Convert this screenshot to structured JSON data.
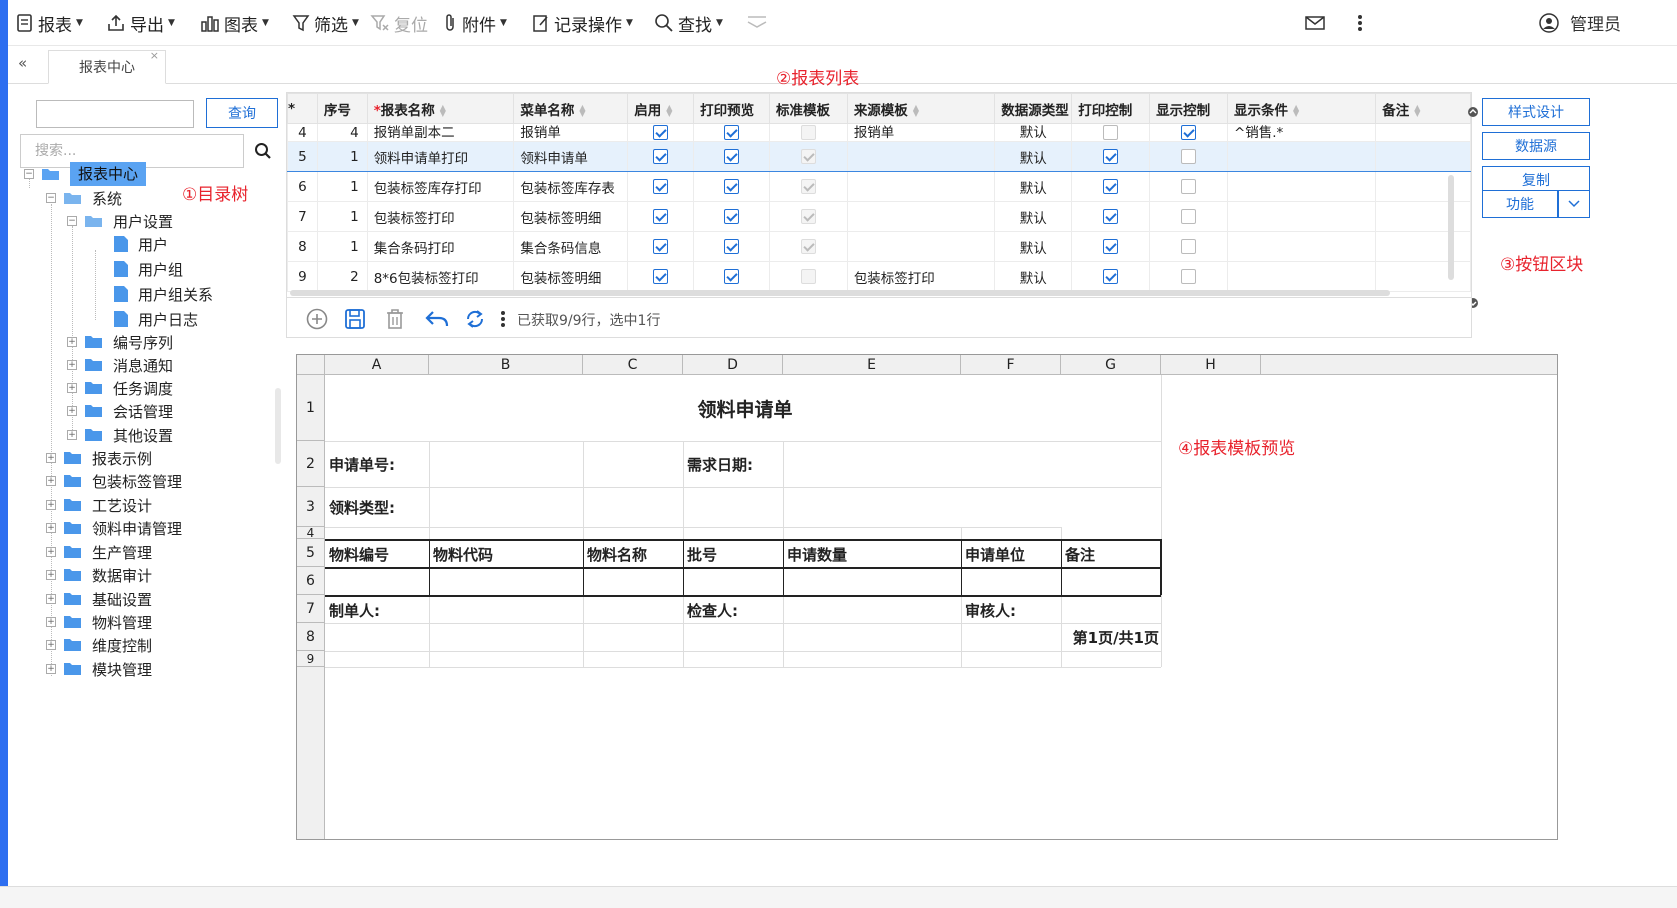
{
  "toolbar": {
    "report": "报表",
    "export": "导出",
    "chart": "图表",
    "filter": "筛选",
    "reset": "复位",
    "attachment": "附件",
    "record_ops": "记录操作",
    "find": "查找",
    "user": "管理员"
  },
  "tabs": {
    "collapse": "«",
    "active_tab": "报表中心",
    "close": "×"
  },
  "tree": {
    "query_button": "查询",
    "search_placeholder": "搜索...",
    "nodes": [
      "报表中心",
      "系统",
      "用户设置",
      "用户",
      "用户组",
      "用户组关系",
      "用户日志",
      "编号序列",
      "消息通知",
      "任务调度",
      "会话管理",
      "其他设置",
      "报表示例",
      "包装标签管理",
      "工艺设计",
      "领料申请管理",
      "生产管理",
      "数据审计",
      "基础设置",
      "物料管理",
      "维度控制",
      "模块管理"
    ]
  },
  "annotations": {
    "tree": "①目录树",
    "list": "②报表列表",
    "buttons": "③按钮区块",
    "preview": "④报表模板预览"
  },
  "grid": {
    "headers": [
      "*",
      "序号",
      "报表名称",
      "菜单名称",
      "启用",
      "打印预览",
      "标准模板",
      "来源模板",
      "数据源类型",
      "打印控制",
      "显示控制",
      "显示条件",
      "备注"
    ],
    "rows": [
      {
        "idx": "4",
        "seq": "4",
        "name": "报销单副本二",
        "menu": "报销单",
        "enabled": true,
        "preview": true,
        "std": false,
        "source": "报销单",
        "ds": "默认",
        "print": false,
        "show": true,
        "cond": "^销售.*",
        "note": ""
      },
      {
        "idx": "5",
        "seq": "1",
        "name": "领料申请单打印",
        "menu": "领料申请单",
        "enabled": true,
        "preview": true,
        "std": true,
        "source": "",
        "ds": "默认",
        "print": true,
        "show": false,
        "cond": "",
        "note": ""
      },
      {
        "idx": "6",
        "seq": "1",
        "name": "包装标签库存打印",
        "menu": "包装标签库存表",
        "enabled": true,
        "preview": true,
        "std": true,
        "source": "",
        "ds": "默认",
        "print": true,
        "show": false,
        "cond": "",
        "note": ""
      },
      {
        "idx": "7",
        "seq": "1",
        "name": "包装标签打印",
        "menu": "包装标签明细",
        "enabled": true,
        "preview": true,
        "std": true,
        "source": "",
        "ds": "默认",
        "print": true,
        "show": false,
        "cond": "",
        "note": ""
      },
      {
        "idx": "8",
        "seq": "1",
        "name": "集合条码打印",
        "menu": "集合条码信息",
        "enabled": true,
        "preview": true,
        "std": true,
        "source": "",
        "ds": "默认",
        "print": true,
        "show": false,
        "cond": "",
        "note": ""
      },
      {
        "idx": "9",
        "seq": "2",
        "name": "8*6包装标签打印",
        "menu": "包装标签明细",
        "enabled": true,
        "preview": true,
        "std": false,
        "source": "包装标签打印",
        "ds": "默认",
        "print": true,
        "show": false,
        "cond": "",
        "note": ""
      }
    ],
    "status": "已获取9/9行，选中1行"
  },
  "side_buttons": {
    "style_design": "样式设计",
    "datasource": "数据源",
    "copy": "复制",
    "function": "功能"
  },
  "sheet": {
    "columns": [
      "A",
      "B",
      "C",
      "D",
      "E",
      "F",
      "G",
      "H"
    ],
    "rows": [
      "1",
      "2",
      "3",
      "4",
      "5",
      "6",
      "7",
      "8",
      "9"
    ],
    "title": "领料申请单",
    "req_no": "申请单号:",
    "req_date": "需求日期:",
    "mat_type": "领料类型:",
    "h_code": "物料编号",
    "h_mcode": "物料代码",
    "h_name": "物料名称",
    "h_batch": "批号",
    "h_qty": "申请数量",
    "h_unit": "申请单位",
    "h_note": "备注",
    "maker": "制单人:",
    "checker": "检查人:",
    "approver": "审核人:",
    "page": "第1页/共1页"
  },
  "colors": {
    "accent": "#1f6fd6",
    "annotation": "#e8232d",
    "selected_tree": "#5aa3f2",
    "left_edge": "#2d6ef0"
  }
}
